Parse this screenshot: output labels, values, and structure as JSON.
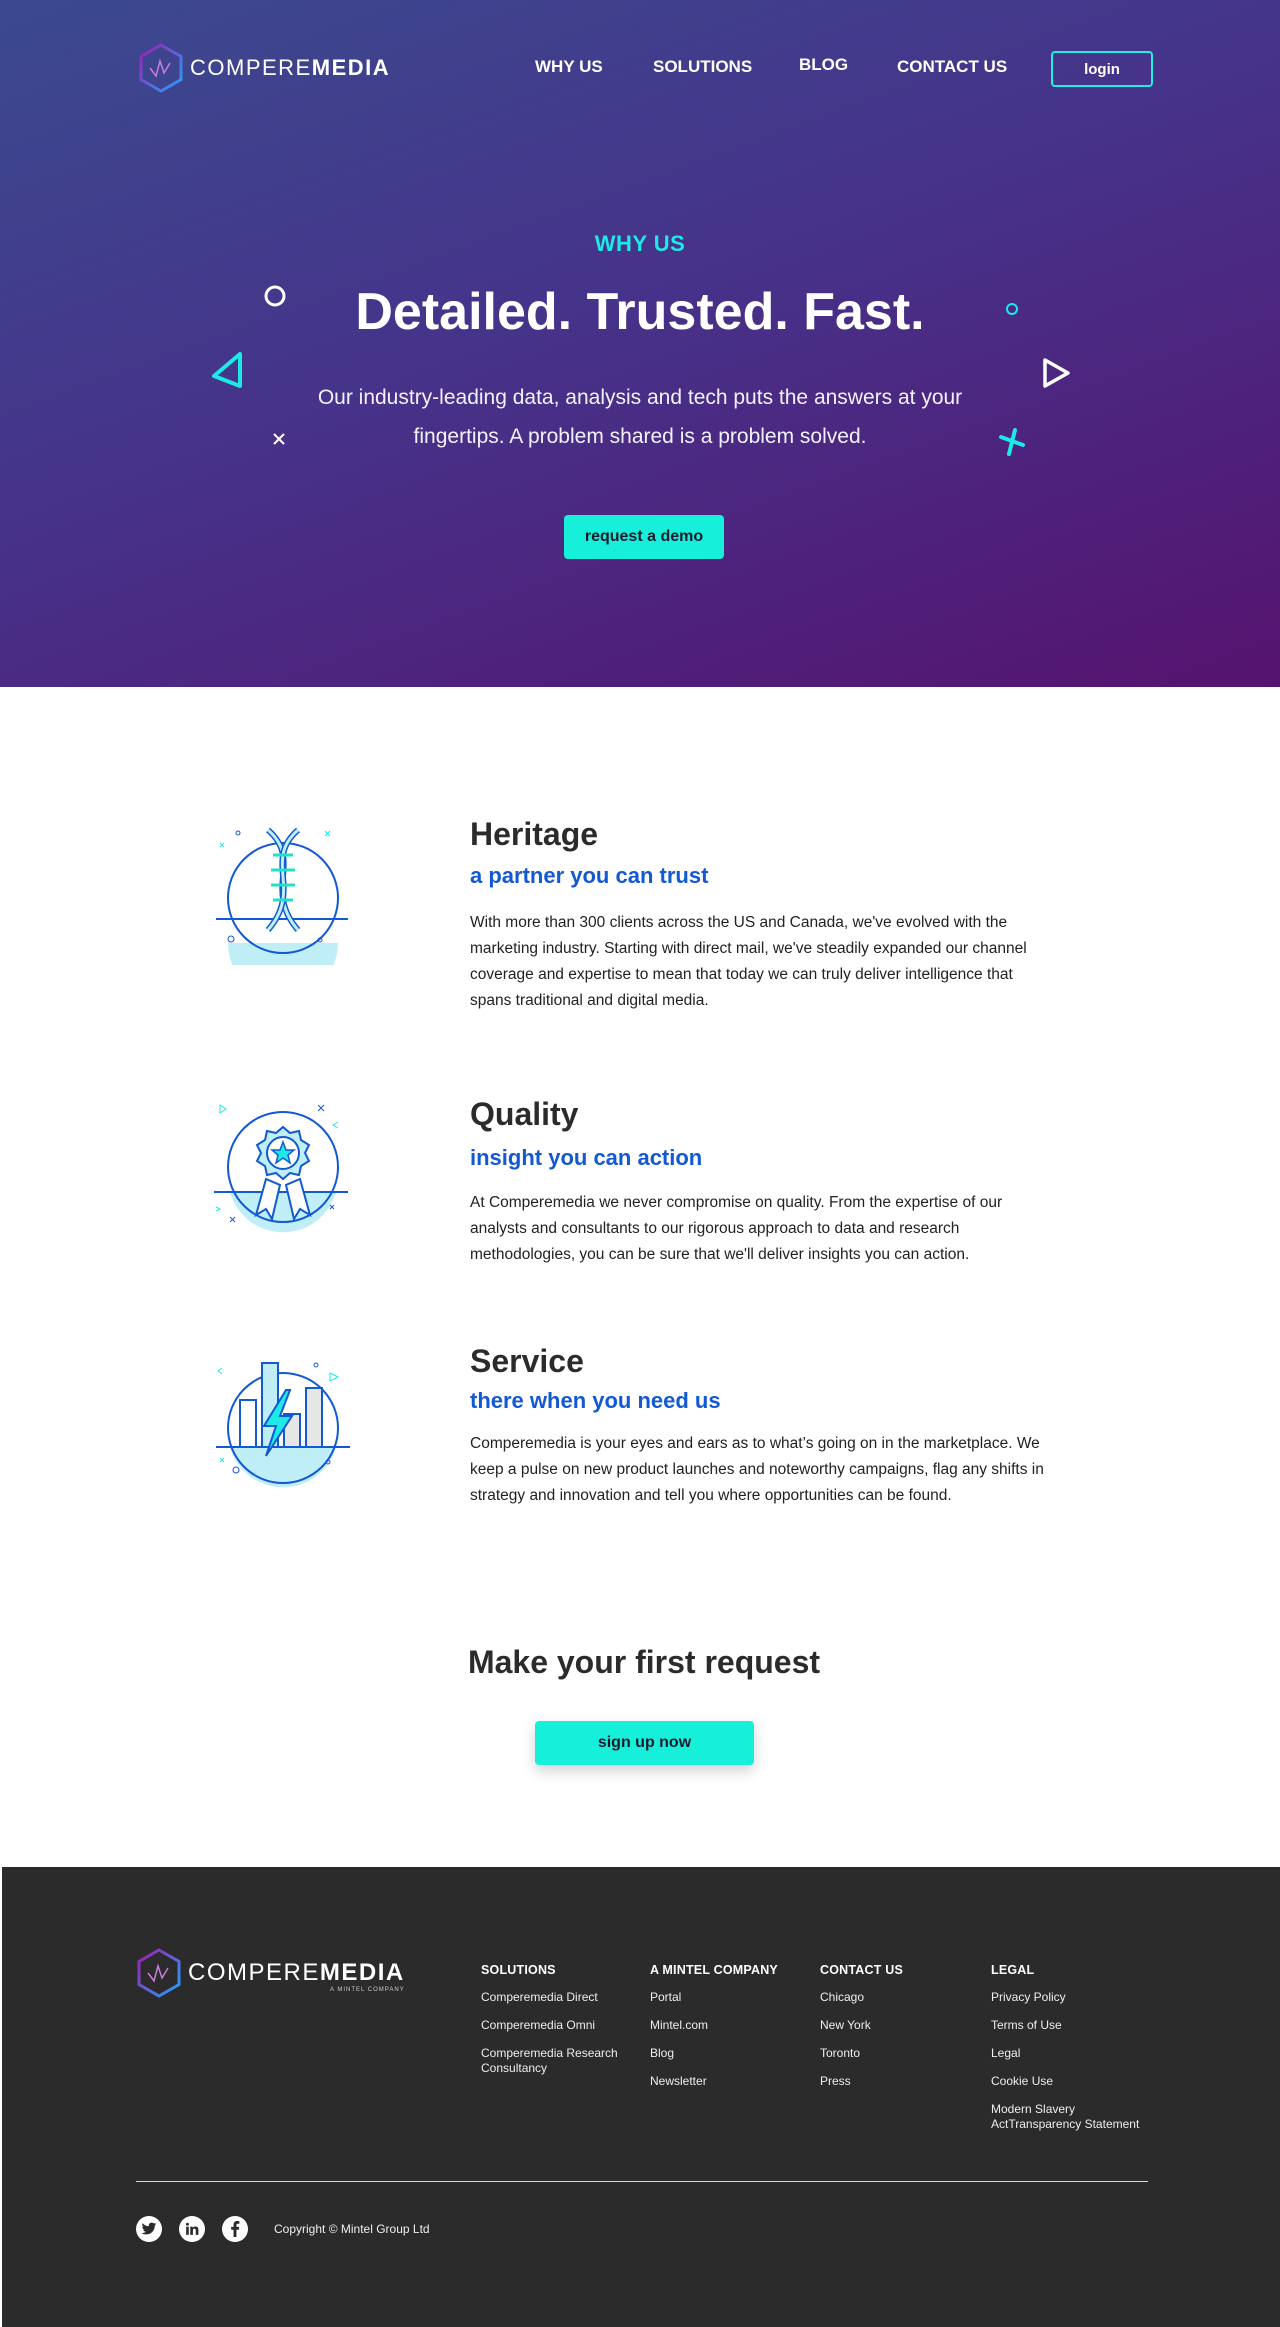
{
  "nav": {
    "logo_light": "COMPERE",
    "logo_bold": "MEDIA",
    "links": [
      "WHY US",
      "SOLUTIONS",
      "BLOG",
      "CONTACT US"
    ],
    "login_label": "login"
  },
  "hero": {
    "eyebrow": "WHY US",
    "title": "Detailed. Trusted. Fast.",
    "subtitle": "Our industry-leading data, analysis and tech puts the answers at your fingertips. A problem shared is a problem solved.",
    "cta_label": "request a demo"
  },
  "features": [
    {
      "icon": "dna-icon",
      "title": "Heritage",
      "tagline": "a partner you can trust",
      "body": "With more than 300 clients across the US and Canada, we've evolved with the marketing industry. Starting with direct mail, we've steadily expanded our channel coverage and expertise to mean that today we can truly deliver intelligence that spans traditional and digital media."
    },
    {
      "icon": "award-ribbon-icon",
      "title": "Quality",
      "tagline": "insight you can action",
      "body": "At Comperemedia we never compromise on quality. From the expertise of our analysts and consultants to our rigorous approach to data and research methodologies, you can be sure that we'll deliver insights you can action."
    },
    {
      "icon": "bar-chart-lightning-icon",
      "title": "Service",
      "tagline": "there when you need us",
      "body": "Comperemedia is your eyes and ears as to what’s going on in the marketplace. We keep a pulse on new product launches and noteworthy campaigns, flag any shifts in strategy and innovation and tell you where opportunities can be found."
    }
  ],
  "cta": {
    "title": "Make your first request",
    "button_label": "sign up now"
  },
  "footer": {
    "logo_light": "COMPERE",
    "logo_bold": "MEDIA",
    "logo_sub": "A MINTEL COMPANY",
    "columns": [
      {
        "heading": "SOLUTIONS",
        "links": [
          "Comperemedia Direct",
          "Comperemedia Omni",
          "Comperemedia Research Consultancy"
        ]
      },
      {
        "heading": "A MINTEL COMPANY",
        "links": [
          "Portal",
          "Mintel.com",
          "Blog",
          "Newsletter"
        ]
      },
      {
        "heading": "CONTACT US",
        "links": [
          "Chicago",
          "New York",
          "Toronto",
          "Press"
        ]
      },
      {
        "heading": "LEGAL",
        "links": [
          "Privacy Policy",
          "Terms of Use",
          "Legal",
          "Cookie Use",
          "Modern Slavery ActTransparency Statement"
        ]
      }
    ],
    "social": [
      "twitter-icon",
      "linkedin-icon",
      "facebook-icon"
    ],
    "copyright": "Copyright © Mintel Group Ltd"
  },
  "colors": {
    "accent": "#16f0da",
    "link_blue": "#1259d3",
    "hero_start": "#3b4a8f",
    "hero_end": "#55136f",
    "footer_bg": "#2b2b2b"
  }
}
